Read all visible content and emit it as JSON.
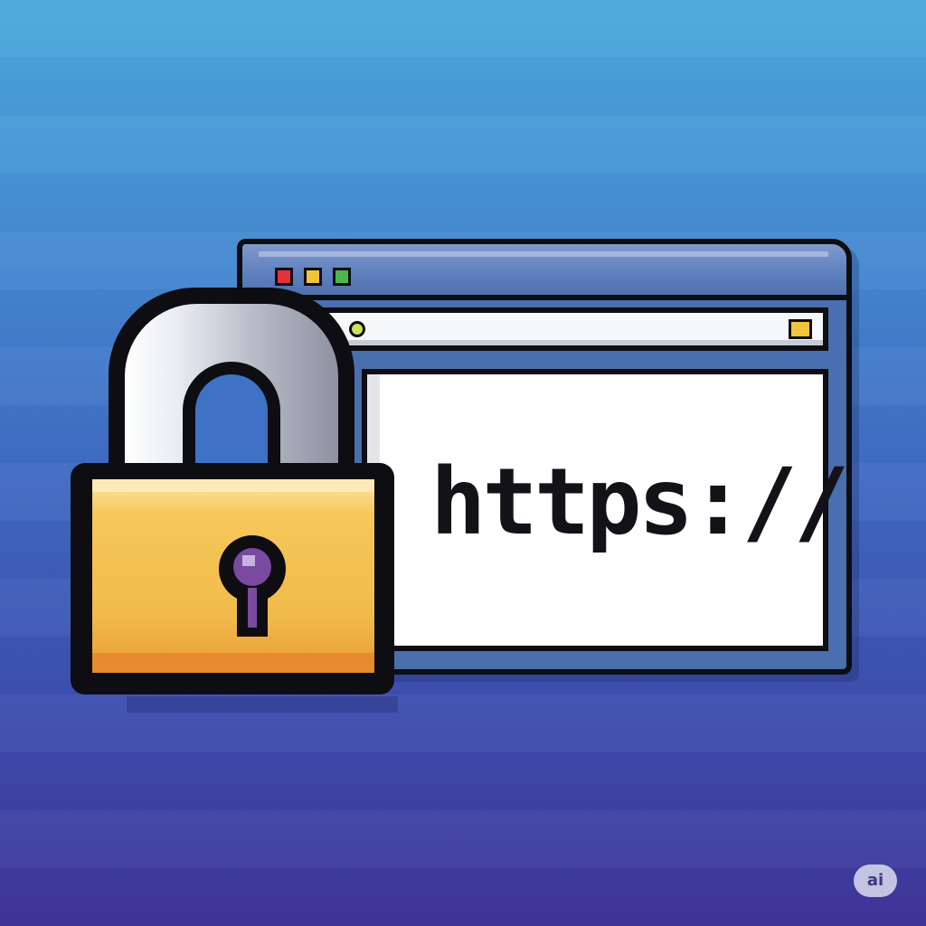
{
  "illustration": {
    "url_text": "https://",
    "badge_text": "ai"
  },
  "icons": {
    "lock": "padlock-icon",
    "window_controls": [
      "red",
      "yellow",
      "green"
    ],
    "address_dots": [
      "green",
      "yellow-green"
    ]
  },
  "colors": {
    "background_top": "#4aa9dc",
    "background_bottom": "#3f3599",
    "lock_gold": "#f1bb4a",
    "keyhole_purple": "#7a4aa0",
    "window_red": "#e5323a",
    "window_yellow": "#f2c43a",
    "window_green": "#48b94a",
    "addr_green": "#48b94a",
    "addr_yellowgreen": "#cfe05a"
  }
}
